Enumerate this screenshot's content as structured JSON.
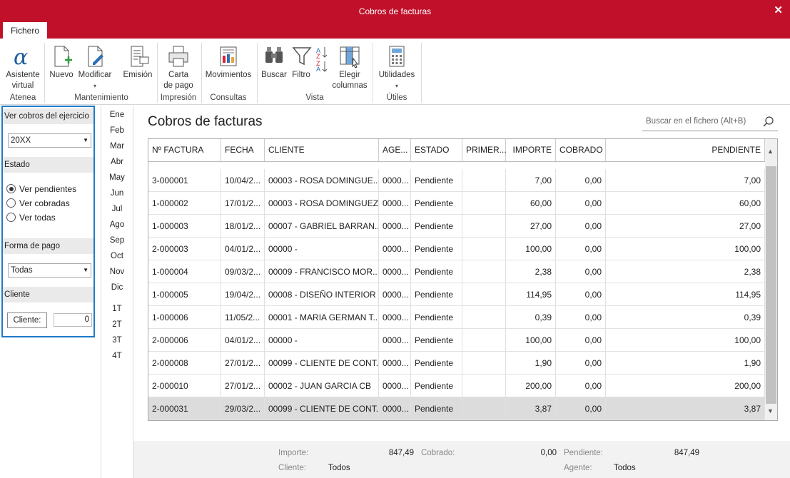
{
  "window": {
    "title": "Cobros de facturas",
    "close_label": "✕"
  },
  "ribbon": {
    "tab": "Fichero",
    "buttons": {
      "asistente": "Asistente\nvirtual",
      "nuevo": "Nuevo",
      "modificar": "Modificar",
      "emision": "Emisión",
      "carta": "Carta\nde pago",
      "movimientos": "Movimientos",
      "buscar": "Buscar",
      "filtro": "Filtro",
      "elegir": "Elegir\ncolumnas",
      "utilidades": "Utilidades"
    },
    "groups": {
      "atenea": "Atenea",
      "mantenimiento": "Mantenimiento",
      "impresion": "Impresión",
      "consultas": "Consultas",
      "vista": "Vista",
      "utiles": "Útiles"
    }
  },
  "filters": {
    "ejercicio_header": "Ver cobros del ejercicio",
    "ejercicio_value": "20XX",
    "estado_header": "Estado",
    "radios": [
      "Ver pendientes",
      "Ver cobradas",
      "Ver todas"
    ],
    "forma_header": "Forma de pago",
    "forma_value": "Todas",
    "cliente_header": "Cliente",
    "cliente_button": "Cliente:",
    "cliente_value": "0"
  },
  "months": [
    "Ene",
    "Feb",
    "Mar",
    "Abr",
    "May",
    "Jun",
    "Jul",
    "Ago",
    "Sep",
    "Oct",
    "Nov",
    "Dic"
  ],
  "quarters": [
    "1T",
    "2T",
    "3T",
    "4T"
  ],
  "main": {
    "title": "Cobros de facturas",
    "search_placeholder": "Buscar en el fichero (Alt+B)"
  },
  "table": {
    "columns": [
      "Nº FACTURA",
      "FECHA",
      "CLIENTE",
      "AGE...",
      "ESTADO",
      "PRIMER...",
      "IMPORTE",
      "COBRADO",
      "PENDIENTE"
    ],
    "rows": [
      [
        "3-000001",
        "10/04/2...",
        "00003 - ROSA DOMINGUE...",
        "0000...",
        "Pendiente",
        "",
        "7,00",
        "0,00",
        "7,00"
      ],
      [
        "1-000002",
        "17/01/2...",
        "00003 - ROSA DOMINGUEZ...",
        "0000...",
        "Pendiente",
        "",
        "60,00",
        "0,00",
        "60,00"
      ],
      [
        "1-000003",
        "18/01/2...",
        "00007 - GABRIEL BARRAN...",
        "0000...",
        "Pendiente",
        "",
        "27,00",
        "0,00",
        "27,00"
      ],
      [
        "2-000003",
        "04/01/2...",
        "00000 -",
        "0000...",
        "Pendiente",
        "",
        "100,00",
        "0,00",
        "100,00"
      ],
      [
        "1-000004",
        "09/03/2...",
        "00009 - FRANCISCO MOR...",
        "0000...",
        "Pendiente",
        "",
        "2,38",
        "0,00",
        "2,38"
      ],
      [
        "1-000005",
        "19/04/2...",
        "00008 - DISEÑO INTERIOR ...",
        "0000...",
        "Pendiente",
        "",
        "114,95",
        "0,00",
        "114,95"
      ],
      [
        "1-000006",
        "11/05/2...",
        "00001 - MARIA GERMAN T...",
        "0000...",
        "Pendiente",
        "",
        "0,39",
        "0,00",
        "0,39"
      ],
      [
        "2-000006",
        "04/01/2...",
        "00000 -",
        "0000...",
        "Pendiente",
        "",
        "100,00",
        "0,00",
        "100,00"
      ],
      [
        "2-000008",
        "27/01/2...",
        "00099 - CLIENTE DE CONT...",
        "0000...",
        "Pendiente",
        "",
        "1,90",
        "0,00",
        "1,90"
      ],
      [
        "2-000010",
        "27/01/2...",
        "00002 - JUAN GARCIA CB",
        "0000...",
        "Pendiente",
        "",
        "200,00",
        "0,00",
        "200,00"
      ],
      [
        "2-000031",
        "29/03/2...",
        "00099 - CLIENTE DE CONT...",
        "0000...",
        "Pendiente",
        "",
        "3,87",
        "0,00",
        "3,87"
      ]
    ]
  },
  "footer": {
    "importe_label": "Importe:",
    "importe_value": "847,49",
    "cobrado_label": "Cobrado:",
    "cobrado_value": "0,00",
    "pendiente_label": "Pendiente:",
    "pendiente_value": "847,49",
    "cliente_label": "Cliente:",
    "cliente_value": "Todos",
    "agente_label": "Agente:",
    "agente_value": "Todos"
  },
  "colors": {
    "titlebar": "#c0102a",
    "selection": "#1f7ac8",
    "accent_green": "#2e9c3e"
  }
}
